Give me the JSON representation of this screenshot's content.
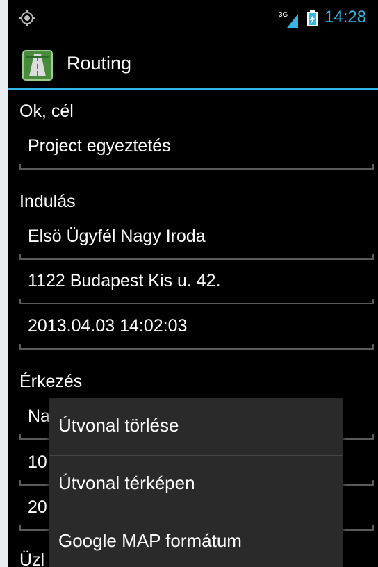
{
  "status_bar": {
    "time": "14:28",
    "network_type": "3G",
    "colors": {
      "clock": "#33b5e5",
      "battery": "#33b5e5"
    }
  },
  "action_bar": {
    "title": "Routing",
    "accent_color": "#33b5e5"
  },
  "form": {
    "goal_label": "Ok, cél",
    "goal_value": "Project egyeztetés",
    "departure_label": "Indulás",
    "departure_name": "Elsö Ügyfél Nagy Iroda",
    "departure_address": "1122 Budapest Kis u. 42.",
    "departure_time": "2013.04.03 14:02:03",
    "arrival_label": "Érkezés",
    "arrival_name_partial": "Na",
    "arrival_address_partial": "10",
    "arrival_time_partial": "20",
    "business_label_partial": "Üzl"
  },
  "context_menu": {
    "items": [
      {
        "label": "Útvonal törlése"
      },
      {
        "label": "Útvonal térképen"
      },
      {
        "label": "Google MAP formátum"
      }
    ]
  }
}
